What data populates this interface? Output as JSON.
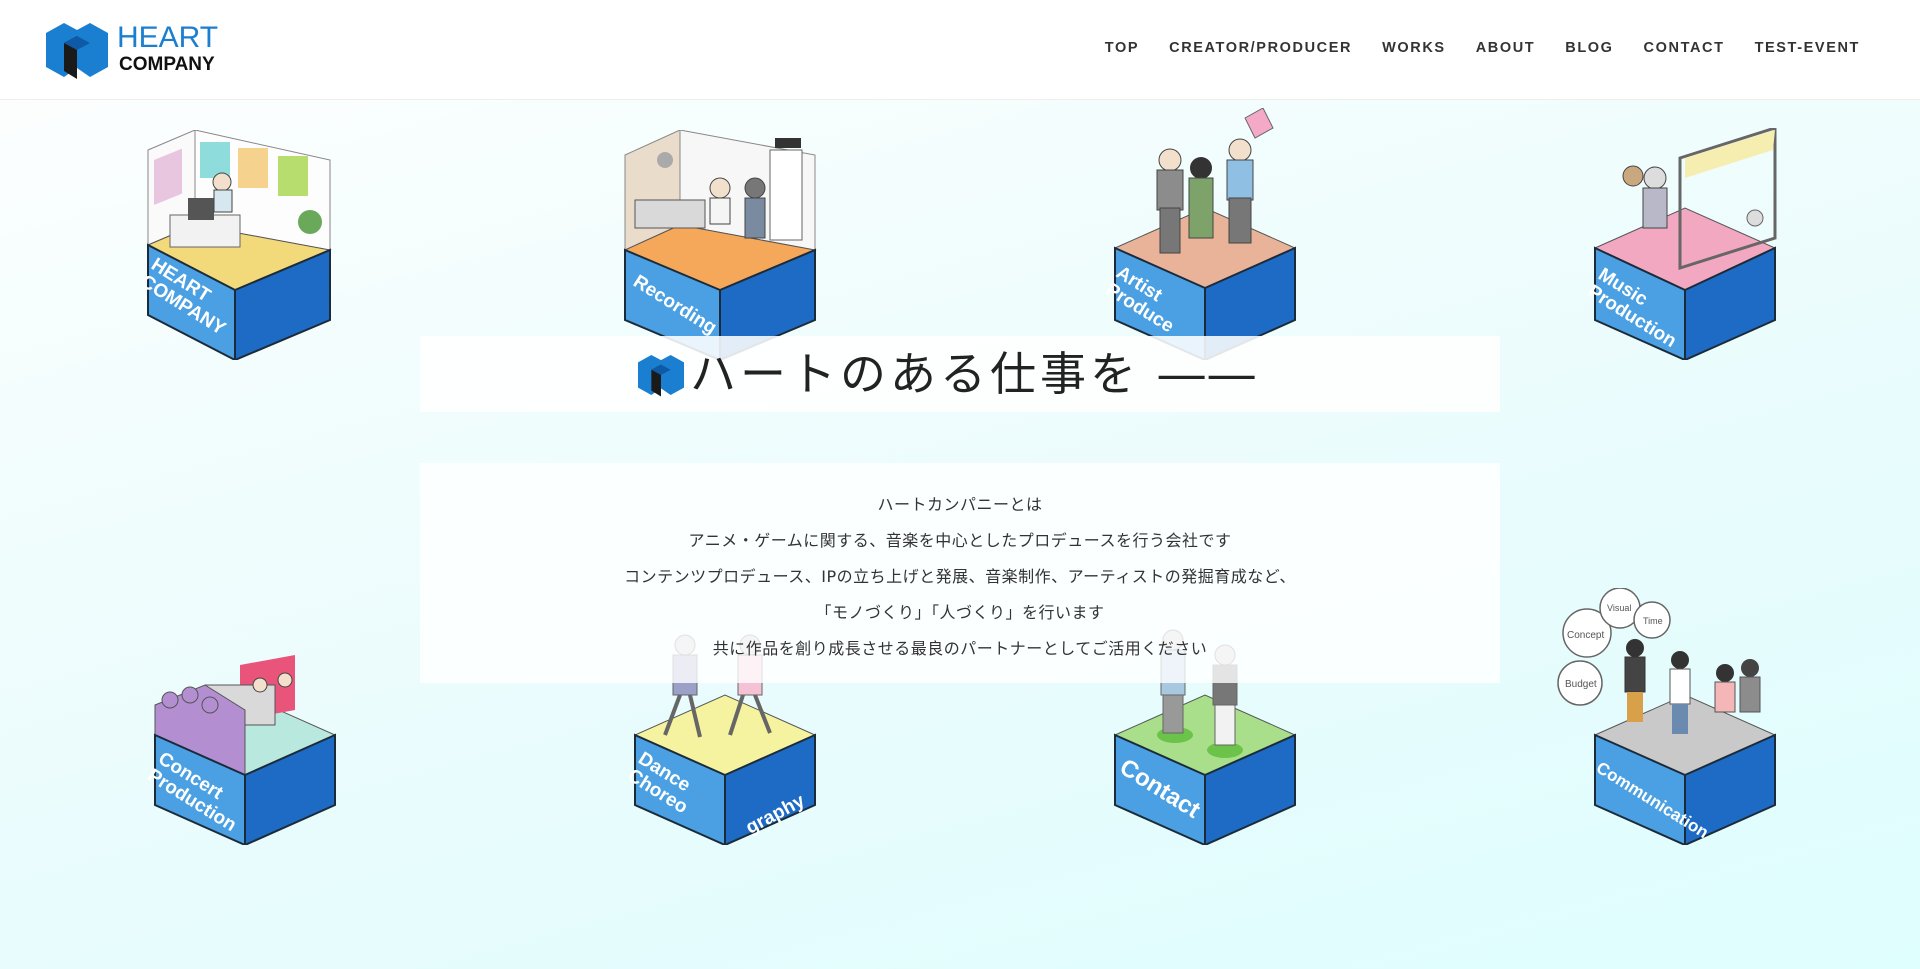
{
  "header": {
    "logo": {
      "word1": "HEART",
      "word2": "COMPANY"
    },
    "nav": [
      {
        "label": "TOP"
      },
      {
        "label": "CREATOR/PRODUCER"
      },
      {
        "label": "WORKS"
      },
      {
        "label": "ABOUT"
      },
      {
        "label": "BLOG"
      },
      {
        "label": "CONTACT"
      },
      {
        "label": "TEST-EVENT"
      }
    ]
  },
  "hero": {
    "headline": "ハートのある仕事を ――",
    "description": [
      "ハートカンパニーとは",
      "アニメ・ゲームに関する、音楽を中心としたプロデュースを行う会社です",
      "コンテンツプロデュース、IPの立ち上げと発展、音楽制作、アーティストの発掘育成など、",
      "「モノづくり」「人づくり」を行います",
      "共に作品を創り成長させる最良のパートナーとしてご活用ください"
    ]
  },
  "boxes": [
    {
      "label": "HEART\nCOMPANY",
      "top_color": "#f2d97a",
      "icon": "office-illustration"
    },
    {
      "label": "Recording",
      "top_color": "#f6a85a",
      "icon": "studio-illustration"
    },
    {
      "label": "Artist\nProduce",
      "top_color": "#e9b39a",
      "icon": "artists-illustration"
    },
    {
      "label": "Music\nProduction",
      "top_color": "#f2a8c0",
      "icon": "stage-illustration"
    },
    {
      "label": "Concert\nProduction",
      "top_color": "#b9e8df",
      "icon": "concert-illustration"
    },
    {
      "label": "Dance\nChoreo",
      "label2": "graphy",
      "top_color": "#f6f3a0",
      "icon": "dance-illustration"
    },
    {
      "label": "Contact",
      "top_color": "#a9df8a",
      "icon": "contact-illustration"
    },
    {
      "label": "Communication",
      "top_color": "#c9c9c9",
      "icon": "communication-illustration"
    }
  ],
  "colors": {
    "brand_blue": "#1a7fd0",
    "box_front": "#4aa0e2",
    "box_side": "#1d6bc4",
    "box_edge": "#1c2b3a"
  }
}
